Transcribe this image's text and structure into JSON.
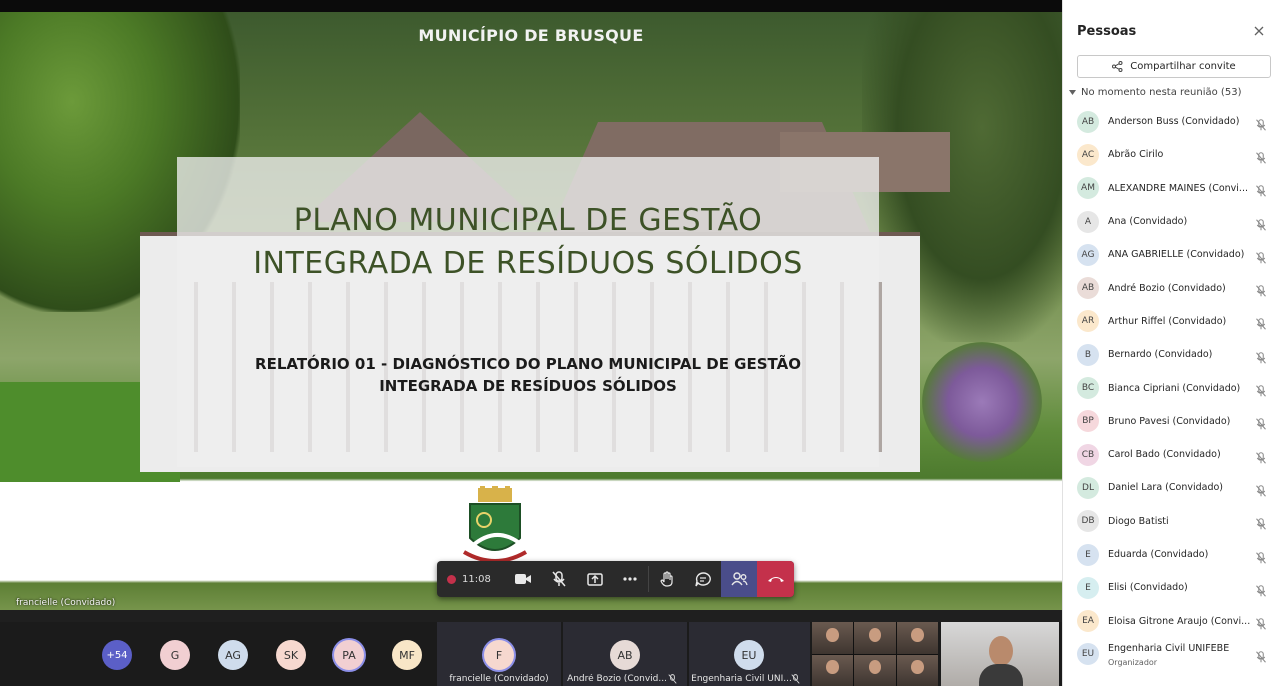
{
  "slide": {
    "header": "MUNICÍPIO DE BRUSQUE",
    "title_lines": [
      "PLANO MUNICIPAL DE GESTÃO",
      "INTEGRADA DE RESÍDUOS SÓLIDOS"
    ],
    "subtitle_lines": [
      "RELATÓRIO 01 - DIAGNÓSTICO DO PLANO MUNICIPAL DE GESTÃO",
      "INTEGRADA DE RESÍDUOS SÓLIDOS"
    ],
    "presenter": "francielle (Convidado)"
  },
  "call": {
    "timer": "11:08",
    "controls": [
      "video-icon",
      "mic-off-icon",
      "share-screen-icon",
      "more-icon",
      "raise-hand-icon",
      "chat-icon",
      "people-icon",
      "hang-up-icon"
    ]
  },
  "strip": {
    "overflow": "+54",
    "avatars": [
      {
        "initials": "G",
        "color": "#f1cfd2"
      },
      {
        "initials": "AG",
        "color": "#cfdcec"
      },
      {
        "initials": "SK",
        "color": "#f6d8cf"
      },
      {
        "initials": "PA",
        "color": "#f1cfd2"
      },
      {
        "initials": "MF",
        "color": "#f8e6c7"
      }
    ],
    "tiles": [
      {
        "initials": "F",
        "color": "#f6d8cf",
        "label": "francielle (Convidado)"
      },
      {
        "initials": "AB",
        "color": "#e6dad6",
        "label": "André Bozio (Convid..."
      },
      {
        "initials": "EU",
        "color": "#cfdcec",
        "label": "Engenharia Civil UNI..."
      }
    ]
  },
  "panel": {
    "title": "Pessoas",
    "share_label": "Compartilhar convite",
    "section_label": "No momento nesta reunião (53)",
    "participants": [
      {
        "initials": "AB",
        "name": "Anderson Buss (Convidado)",
        "color": "#d4eadf"
      },
      {
        "initials": "AC",
        "name": "Abrão Cirilo",
        "color": "#fbe8cc"
      },
      {
        "initials": "AM",
        "name": "ALEXANDRE MAINES (Convi...",
        "color": "#d4eadf"
      },
      {
        "initials": "A",
        "name": "Ana (Convidado)",
        "color": "#e6e6e6"
      },
      {
        "initials": "AG",
        "name": "ANA GABRIELLE (Convidado)",
        "color": "#d6e2f0"
      },
      {
        "initials": "AB",
        "name": "André Bozio (Convidado)",
        "color": "#eadcd8"
      },
      {
        "initials": "AR",
        "name": "Arthur Riffel (Convidado)",
        "color": "#fbe8cc"
      },
      {
        "initials": "B",
        "name": "Bernardo (Convidado)",
        "color": "#d6e2f0"
      },
      {
        "initials": "BC",
        "name": "Bianca Cipriani (Convidado)",
        "color": "#d4eadf"
      },
      {
        "initials": "BP",
        "name": "Bruno Pavesi (Convidado)",
        "color": "#f6d8dc"
      },
      {
        "initials": "CB",
        "name": "Carol Bado (Convidado)",
        "color": "#f0d6e4"
      },
      {
        "initials": "DL",
        "name": "Daniel Lara (Convidado)",
        "color": "#d4eadf"
      },
      {
        "initials": "DB",
        "name": "Diogo Batisti",
        "color": "#e6e6e6"
      },
      {
        "initials": "E",
        "name": "Eduarda (Convidado)",
        "color": "#d6e2f0"
      },
      {
        "initials": "E",
        "name": "Elisi (Convidado)",
        "color": "#d6eef0"
      },
      {
        "initials": "EA",
        "name": "Eloisa Gitrone Araujo (Convi...",
        "color": "#fbe8cc"
      },
      {
        "initials": "EU",
        "name": "Engenharia Civil UNIFEBE",
        "role": "Organizador",
        "color": "#d6e2f0"
      }
    ]
  }
}
